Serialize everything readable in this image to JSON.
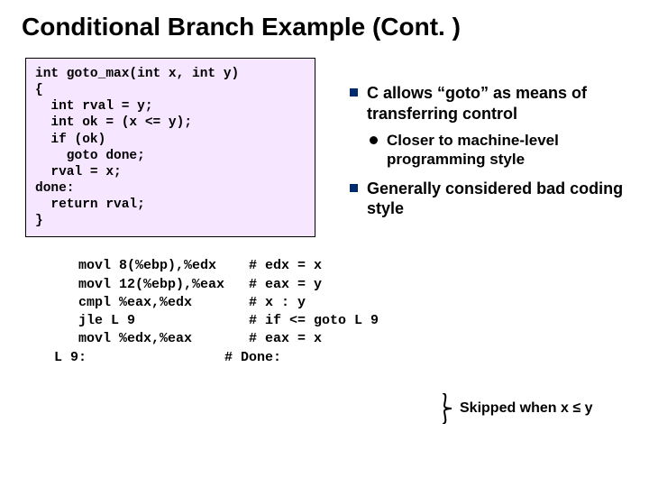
{
  "title": "Conditional Branch Example (Cont. )",
  "code_c": "int goto_max(int x, int y)\n{\n  int rval = y;\n  int ok = (x <= y);\n  if (ok)\n    goto done;\n  rval = x;\ndone:\n  return rval;\n}",
  "bullets": {
    "b1": "C allows “goto” as means of transferring control",
    "b1_sub": "Closer to machine-level programming style",
    "b2": "Generally considered bad coding style"
  },
  "asm": "   movl 8(%ebp),%edx    # edx = x\n   movl 12(%ebp),%eax   # eax = y\n   cmpl %eax,%edx       # x : y\n   jle L 9              # if <= goto L 9\n   movl %edx,%eax       # eax = x\nL 9:                 # Done:",
  "skip_label": "Skipped when x ≤ y",
  "chart_data": {
    "type": "table",
    "title": "Assembly with comments",
    "rows": [
      {
        "instr": "movl 8(%ebp),%edx",
        "comment": "edx = x"
      },
      {
        "instr": "movl 12(%ebp),%eax",
        "comment": "eax = y"
      },
      {
        "instr": "cmpl %eax,%edx",
        "comment": "x : y"
      },
      {
        "instr": "jle L 9",
        "comment": "if <= goto L 9"
      },
      {
        "instr": "movl %edx,%eax",
        "comment": "eax = x"
      },
      {
        "instr": "L 9:",
        "comment": "Done:"
      }
    ]
  }
}
